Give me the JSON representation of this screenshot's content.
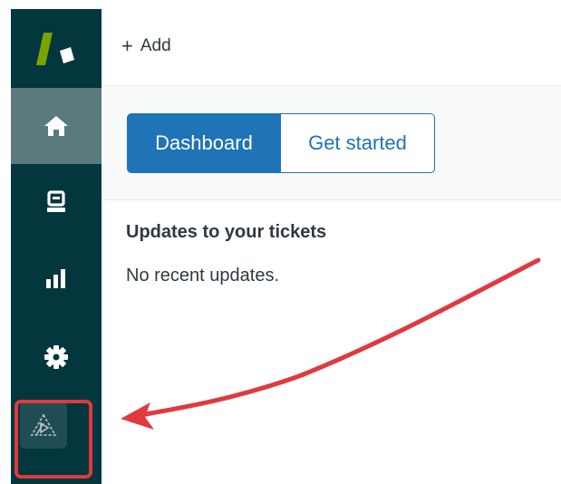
{
  "topbar": {
    "add_label": "Add"
  },
  "tabs": [
    {
      "label": "Dashboard",
      "active": true
    },
    {
      "label": "Get started",
      "active": false
    }
  ],
  "updates": {
    "title": "Updates to your tickets",
    "empty_text": "No recent updates."
  },
  "sidebar": {
    "items": [
      {
        "icon": "home-icon",
        "active": true
      },
      {
        "icon": "views-icon",
        "active": false
      },
      {
        "icon": "reports-icon",
        "active": false
      },
      {
        "icon": "gear-icon",
        "active": false
      },
      {
        "icon": "app-icon",
        "active": false
      }
    ]
  },
  "colors": {
    "sidebar_bg": "#03363d",
    "sidebar_active": "#5a7a7e",
    "primary_blue": "#1f73b7",
    "logo_green": "#78a300",
    "annotation_red": "#e0393e"
  }
}
